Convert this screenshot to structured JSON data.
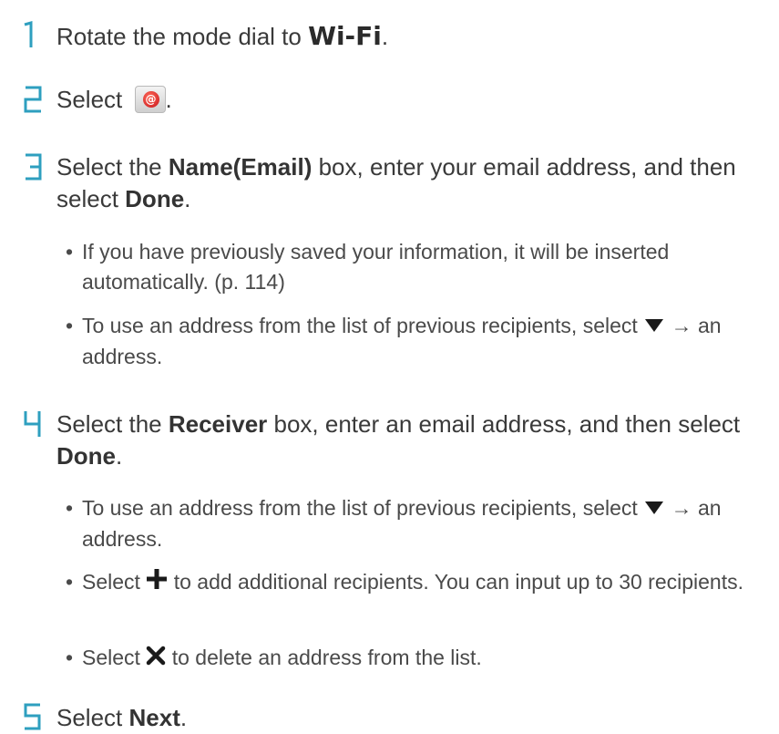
{
  "steps": [
    {
      "number": "1",
      "text_before": "Rotate the mode dial to ",
      "mode_label": "Wi-Fi",
      "text_after": "."
    },
    {
      "number": "2",
      "text_before": "Select ",
      "icon": "email-app-icon",
      "text_after": "."
    },
    {
      "number": "3",
      "parts": [
        "Select the ",
        "Name(Email)",
        " box, enter your email address, and then select ",
        "Done",
        "."
      ],
      "bullets": [
        {
          "text": "If you have previously saved your information, it will be inserted automatically. (p. 114)"
        },
        {
          "text_before": "To use an address from the list of previous recipients, select ",
          "icon": "triangle-down-icon",
          "text_after": " → an address."
        }
      ]
    },
    {
      "number": "4",
      "parts": [
        "Select the ",
        "Receiver",
        " box, enter an email address, and then select ",
        "Done",
        "."
      ],
      "bullets": [
        {
          "text_before": "To use an address from the list of previous recipients, select ",
          "icon": "triangle-down-icon",
          "text_after": " → an address."
        },
        {
          "text_before": "Select ",
          "icon": "plus-icon",
          "text_after": " to add additional recipients. You can input up to 30 recipients."
        },
        {
          "text_before": "Select ",
          "icon": "x-icon",
          "text_after": " to delete an address from the list."
        }
      ]
    },
    {
      "number": "5",
      "parts": [
        "Select ",
        "Next",
        "."
      ]
    }
  ],
  "bullet_char": "•",
  "colors": {
    "step_number": "#2e9fbf",
    "text": "#3a3a3a",
    "icon_dark": "#1a1a1a",
    "email_icon_red": "#c8151b"
  }
}
